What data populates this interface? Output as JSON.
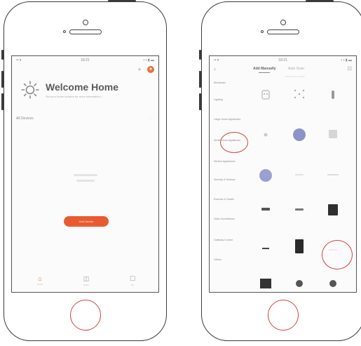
{
  "left_phone": {
    "status": {
      "signal": "•• ▾",
      "time": "18:21",
      "battery": "▪ ▪ ▮ ▬"
    },
    "welcome_title": "Welcome Home",
    "welcome_subtitle": "Set your home location for more information >",
    "home_label": "All Devices",
    "home_label_arrow": "···",
    "add_device_button": "Add Device",
    "tabs": [
      {
        "label": "Home"
      },
      {
        "label": "Smart"
      },
      {
        "label": "Me"
      }
    ]
  },
  "right_phone": {
    "status": {
      "signal": "•• ▾",
      "time": "18:21",
      "battery": "▪ ▪ ▮ ▬"
    },
    "header": {
      "tab_manual": "Add Manually",
      "tab_auto": "Auto Scan",
      "hint": "Scan devices nearby"
    },
    "categories": [
      "Electrician",
      "Lighting",
      "Large Home Appliances",
      "Small Home Appliances",
      "Kitchen Appliances",
      "Security & Sensors",
      "Exercise & Health",
      "Video Surveillance",
      "Gateway Control",
      "Others"
    ],
    "highlighted_category_index": 3
  },
  "colors": {
    "accent": "#e85b31",
    "highlight_ring": "#d3443b",
    "frame": "#3a3a3a"
  }
}
